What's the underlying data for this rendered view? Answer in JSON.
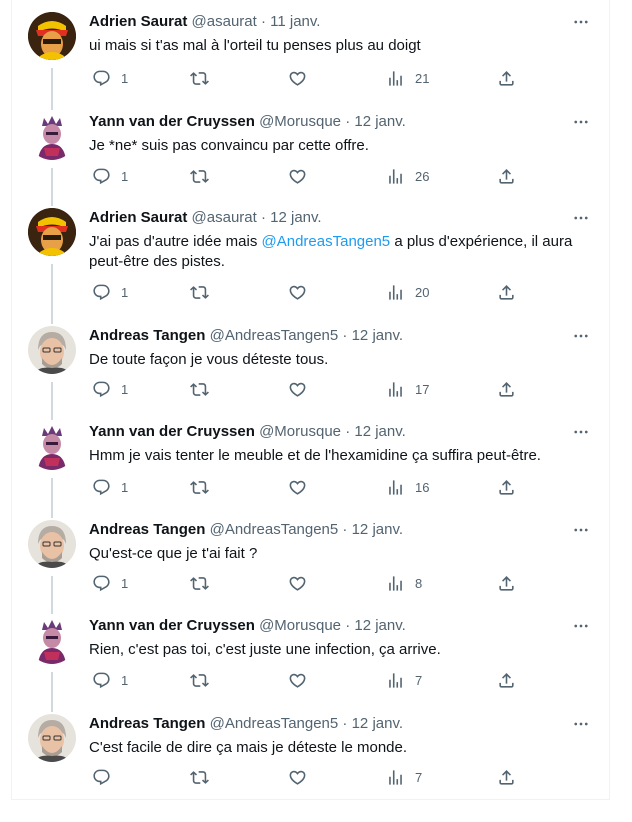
{
  "tweets": [
    {
      "name": "Adrien Saurat",
      "handle": "@asaurat",
      "date": "11 janv.",
      "text_parts": [
        "ui mais si t'as mal à l'orteil tu penses plus au doigt"
      ],
      "replies": "1",
      "views": "21",
      "avatar": "avatar-adrien"
    },
    {
      "name": "Yann van der Cruyssen",
      "handle": "@Morusque",
      "date": "12 janv.",
      "text_parts": [
        "Je *ne* suis pas convaincu par cette offre."
      ],
      "replies": "1",
      "views": "26",
      "avatar": "avatar-yann"
    },
    {
      "name": "Adrien Saurat",
      "handle": "@asaurat",
      "date": "12 janv.",
      "text_parts": [
        "J'ai pas d'autre idée mais ",
        "@AndreasTangen5",
        " a plus d'expérience, il aura",
        "peut-être des pistes."
      ],
      "replies": "1",
      "views": "20",
      "avatar": "avatar-adrien"
    },
    {
      "name": "Andreas Tangen",
      "handle": "@AndreasTangen5",
      "date": "12 janv.",
      "text_parts": [
        "De toute façon je vous déteste tous."
      ],
      "replies": "1",
      "views": "17",
      "avatar": "avatar-andreas"
    },
    {
      "name": "Yann van der Cruyssen",
      "handle": "@Morusque",
      "date": "12 janv.",
      "text_parts": [
        "Hmm je vais tenter le meuble et de l'hexamidine ça suffira peut-être."
      ],
      "replies": "1",
      "views": "16",
      "avatar": "avatar-yann"
    },
    {
      "name": "Andreas Tangen",
      "handle": "@AndreasTangen5",
      "date": "12 janv.",
      "text_parts": [
        "Qu'est-ce que je t'ai fait ?"
      ],
      "replies": "1",
      "views": "8",
      "avatar": "avatar-andreas"
    },
    {
      "name": "Yann van der Cruyssen",
      "handle": "@Morusque",
      "date": "12 janv.",
      "text_parts": [
        "Rien, c'est pas toi, c'est juste une infection, ça arrive."
      ],
      "replies": "1",
      "views": "7",
      "avatar": "avatar-yann"
    },
    {
      "name": "Andreas Tangen",
      "handle": "@AndreasTangen5",
      "date": "12 janv.",
      "text_parts": [
        "C'est facile de dire ça mais je déteste le monde."
      ],
      "replies": "",
      "views": "7",
      "avatar": "avatar-andreas"
    }
  ],
  "separator": "·",
  "colors": {
    "text": "#0f1419",
    "secondary": "#536471",
    "link": "#1d9bf0",
    "thread_line": "#cfd9de",
    "border": "#eff3f4"
  },
  "icons": [
    "more-icon",
    "reply-icon",
    "retweet-icon",
    "like-icon",
    "views-icon",
    "share-icon"
  ]
}
